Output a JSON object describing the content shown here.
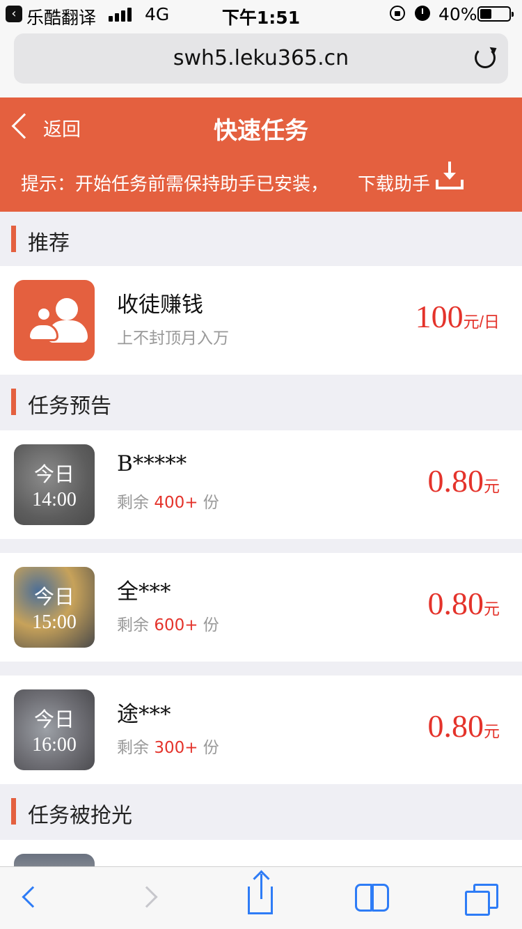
{
  "status_bar": {
    "app_name": "乐酷翻译",
    "network": "4G",
    "time": "下午1:51",
    "battery": "40%"
  },
  "browser": {
    "url": "swh5.leku365.cn"
  },
  "header": {
    "back_label": "返回",
    "title": "快速任务",
    "tip": "提示：开始任务前需保持助手已安装，",
    "download_label": "下载助手",
    "accent_color": "#e4603f"
  },
  "sections": {
    "recommended": {
      "title": "推荐"
    },
    "preview": {
      "title": "任务预告"
    },
    "sold_out": {
      "title": "任务被抢光"
    }
  },
  "recommended_item": {
    "name": "收徒赚钱",
    "subtitle": "上不封顶月入万",
    "price": "100",
    "unit": "元/日",
    "icon": "people-icon"
  },
  "preview_items": [
    {
      "day": "今日",
      "time": "14:00",
      "name": "B*****",
      "remain_prefix": "剩余",
      "count": "400+",
      "remain_suffix": "份",
      "price": "0.80",
      "unit": "元"
    },
    {
      "day": "今日",
      "time": "15:00",
      "name": "全***",
      "remain_prefix": "剩余",
      "count": "600+",
      "remain_suffix": "份",
      "price": "0.80",
      "unit": "元"
    },
    {
      "day": "今日",
      "time": "16:00",
      "name": "途***",
      "remain_prefix": "剩余",
      "count": "300+",
      "remain_suffix": "份",
      "price": "0.80",
      "unit": "元"
    }
  ],
  "colors": {
    "price_red": "#e4332b",
    "ios_blue": "#2e7cf6"
  }
}
